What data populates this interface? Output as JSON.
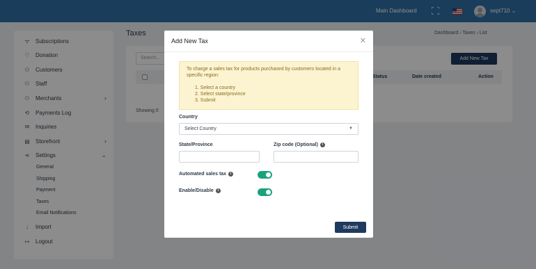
{
  "topbar": {
    "main_dashboard": "Main Dashboard",
    "username": "sept710 ⌄"
  },
  "sidebar": {
    "items": [
      {
        "label": "Subscriptions",
        "icon": "rss-icon"
      },
      {
        "label": "Donation",
        "icon": "heart-icon"
      },
      {
        "label": "Customers",
        "icon": "users-icon"
      },
      {
        "label": "Staff",
        "icon": "staff-icon"
      },
      {
        "label": "Merchants",
        "icon": "merchants-icon"
      },
      {
        "label": "Payments Log",
        "icon": "refresh-icon"
      },
      {
        "label": "Inquiries",
        "icon": "mail-icon"
      },
      {
        "label": "Storefront",
        "icon": "storefront-icon"
      },
      {
        "label": "Settings",
        "icon": "share-icon"
      },
      {
        "label": "Import",
        "icon": "import-icon"
      },
      {
        "label": "Logout",
        "icon": "logout-icon"
      }
    ],
    "settings_sub": [
      "General",
      "Shipping",
      "Payment",
      "Taxes",
      "Email Notifications"
    ]
  },
  "main": {
    "title": "Taxes",
    "breadcrumb": "Dashboard  ›  Taxes  ›  List",
    "search_placeholder": "Search...",
    "add_button": "Add New Tax",
    "columns": [
      "Status",
      "Date created",
      "Action"
    ],
    "showing": "Showing 0"
  },
  "modal": {
    "title": "Add New Tax",
    "notice_intro": "To charge a sales tax for products purchased by customers located in a specific region:",
    "notice_steps": [
      "1. Select a country",
      "2. Select state/province",
      "3. Submit"
    ],
    "country_label": "Country",
    "country_value": "Select Country",
    "state_label": "State/Province",
    "zip_label": "Zip code (Optional)",
    "automated_label": "Automated sales tax",
    "enable_label": "Enable/Disable",
    "submit": "Submit",
    "toggles": {
      "automated": true,
      "enabled": true
    }
  },
  "colors": {
    "topbar": "#2f6fa7",
    "primary_button": "#1e3a5f",
    "toggle_on": "#1aa37a",
    "notice_bg": "#fcf3d1"
  }
}
